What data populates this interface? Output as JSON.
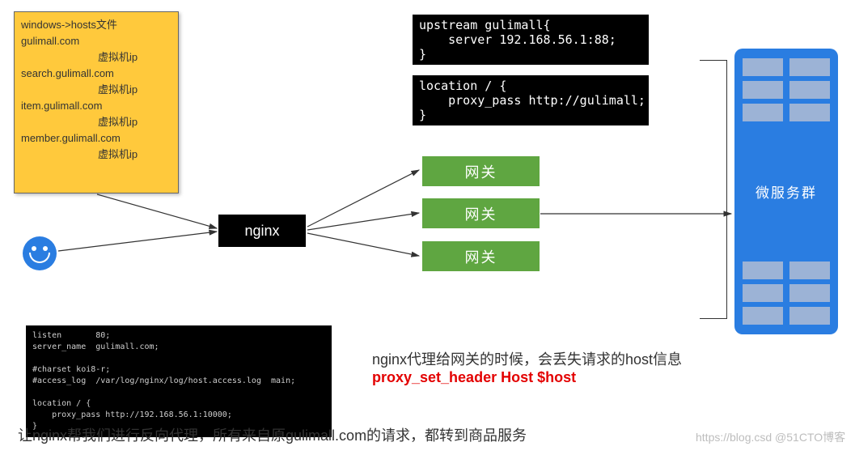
{
  "hosts": {
    "title": "windows->hosts文件",
    "lines": [
      "gulimall.com",
      "虚拟机ip",
      "search.gulimall.com",
      "虚拟机ip",
      "item.gulimall.com",
      "",
      "虚拟机ip",
      "member.gulimall.com",
      "虚拟机ip"
    ]
  },
  "nginx_label": "nginx",
  "gateways": {
    "g1": "网关",
    "g2": "网关",
    "g3": "网关"
  },
  "code_upstream": "upstream gulimall{\n    server 192.168.56.1:88;\n}",
  "code_location": "location / {\n    proxy_pass http://gulimall;\n}",
  "code_server": "listen       80;\nserver_name  gulimall.com;\n\n#charset koi8-r;\n#access_log  /var/log/nginx/log/host.access.log  main;\n\nlocation / {\n    proxy_pass http://192.168.56.1:10000;\n}",
  "cluster_label": "微服务群",
  "caption_info": "nginx代理给网关的时候，会丢失请求的host信息",
  "caption_fix": "proxy_set_header Host $host",
  "caption_bottom": "让nginx帮我们进行反向代理，所有来自原gulimall.com的请求，都转到商品服务",
  "watermark": "https://blog.csd @51CTO博客"
}
